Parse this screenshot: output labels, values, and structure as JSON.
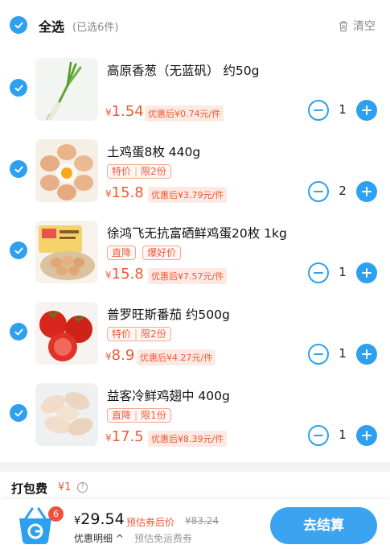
{
  "header": {
    "select_all_label": "全选",
    "selected_count": "(已选6件)",
    "clear_label": "清空"
  },
  "items": [
    {
      "title": "高原香葱（无蓝矾） 约50g",
      "tags": [],
      "price": "1.54",
      "after_discount": "优惠后¥0.74元/件",
      "qty": "1",
      "image": "green-onion"
    },
    {
      "title": "土鸡蛋8枚 440g",
      "tags": [
        [
          "特价",
          "限2份"
        ]
      ],
      "price": "15.8",
      "after_discount": "优惠后¥3.79元/件",
      "qty": "2",
      "image": "eggs"
    },
    {
      "title": "徐鸿飞无抗富硒鲜鸡蛋20枚 1kg",
      "tags": [
        [
          "直降"
        ],
        [
          "爆好价"
        ]
      ],
      "price": "15.8",
      "after_discount": "优惠后¥7.57元/件",
      "qty": "1",
      "image": "egg-box"
    },
    {
      "title": "普罗旺斯番茄 约500g",
      "tags": [
        [
          "特价",
          "限2份"
        ]
      ],
      "price": "8.9",
      "after_discount": "优惠后¥4.27元/件",
      "qty": "1",
      "image": "tomatoes"
    },
    {
      "title": "益客冷鲜鸡翅中 400g",
      "tags": [
        [
          "直降",
          "限1份"
        ]
      ],
      "price": "17.5",
      "after_discount": "优惠后¥8.39元/件",
      "qty": "1",
      "image": "chicken-wings"
    }
  ],
  "packing_fee": {
    "label": "打包费",
    "value": "¥1"
  },
  "footer": {
    "cart_badge": "6",
    "currency": "¥",
    "total": "29.54",
    "estimate_label": "预估券后价",
    "original_price": "¥83.24",
    "detail_label": "优惠明细 ^",
    "detail_note": "预估免运费券",
    "checkout_label": "去结算"
  },
  "colors": {
    "accent": "#2ea0f0",
    "price": "#ee5a32",
    "checkout": "#3aa4f0"
  }
}
